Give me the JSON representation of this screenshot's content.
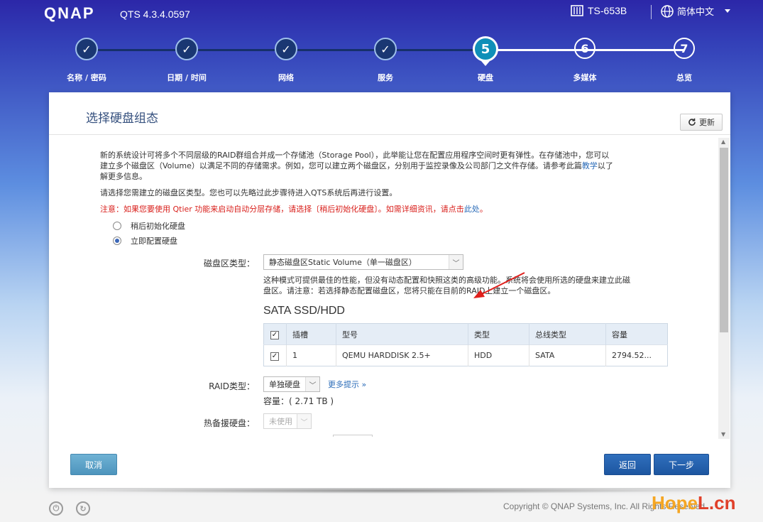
{
  "header": {
    "logo": "QNAP",
    "version": "QTS 4.3.4.0597",
    "model": "TS-653B",
    "language": "简体中文"
  },
  "steps": [
    {
      "num": "1",
      "label": "名称 / 密码",
      "state": "done"
    },
    {
      "num": "2",
      "label": "日期 / 时间",
      "state": "done"
    },
    {
      "num": "3",
      "label": "网络",
      "state": "done"
    },
    {
      "num": "4",
      "label": "服务",
      "state": "done"
    },
    {
      "num": "5",
      "label": "硬盘",
      "state": "active"
    },
    {
      "num": "6",
      "label": "多媒体",
      "state": "todo"
    },
    {
      "num": "7",
      "label": "总览",
      "state": "todo"
    }
  ],
  "panel": {
    "title": "选择硬盘组态",
    "refresh_label": "更新",
    "intro_line1": "新的系统设计可将多个不同层级的RAID群组合并成一个存储池（Storage Pool），此举能让您在配置应用程序空间时更有弹性。在存储池中，您可以",
    "intro_line2": "建立多个磁盘区（Volume）以满足不同的存储需求。例如，您可以建立两个磁盘区，分别用于监控录像及公司部门之文件存储。请参考此篇",
    "intro_link": "教学",
    "intro_line2_end": "以了",
    "intro_line3": "解更多信息。",
    "choose_line": "请选择您需建立的磁盘区类型。您也可以先略过此步骤待进入QTS系统后再进行设置。",
    "note_text": "注意：如果您要使用 Qtier 功能来启动自动分层存储，请选择〔稍后初始化硬盘〕。如需详细资讯，请点击",
    "note_link": "此处",
    "note_end": "。",
    "radio_later": "稍后初始化硬盘",
    "radio_now": "立即配置硬盘",
    "volume_type_label": "磁盘区类型：",
    "volume_type_value": "静态磁盘区Static Volume（单一磁盘区）",
    "desc_line1": "这种模式可提供最佳的性能，但没有动态配置和快照这类的高级功能。系统将会使用所选的硬盘来建立此磁",
    "desc_line2": "盘区。请注意：若选择静态配置磁盘区，您将只能在目前的RAID上建立一个磁盘区。",
    "disk_section_title": "SATA SSD/HDD",
    "table_headers": [
      "插槽",
      "型号",
      "类型",
      "总线类型",
      "容量"
    ],
    "table_rows": [
      {
        "slot": "1",
        "model": "QEMU HARDDISK 2.5+",
        "type": "HDD",
        "bus": "SATA",
        "capacity": "2794.52..."
      }
    ],
    "raid_label": "RAID类型：",
    "raid_value": "单独硬盘",
    "more_tips": "更多提示 »",
    "capacity_text": "容量：( 2.71 TB )",
    "hot_spare_label": "热备援硬盘：",
    "hot_spare_value": "未使用"
  },
  "buttons": {
    "cancel": "取消",
    "back": "返回",
    "next": "下一步"
  },
  "footer": {
    "copyright": "Copyright © QNAP Systems, Inc. All Rights Reserved.",
    "watermark_a": "Hope",
    "watermark_b": "L.cn"
  },
  "colors": {
    "accent": "#1d56a0",
    "warning": "#d9201c",
    "link": "#2b6cb8",
    "active_step": "#0f8fb8"
  }
}
